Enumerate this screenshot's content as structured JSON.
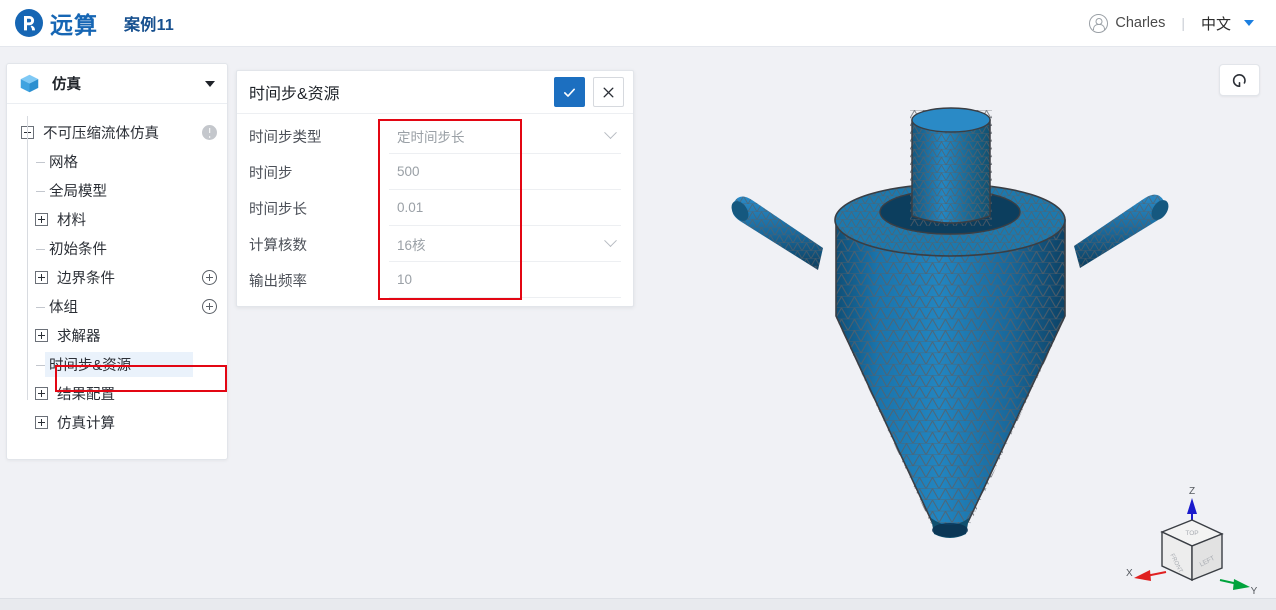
{
  "header": {
    "logo_icon": "yuansuan-logo-icon",
    "brand": "远算",
    "case_title": "案例11",
    "user_icon": "user-circle-icon",
    "user_name": "Charles",
    "divider": "|",
    "language": "中文",
    "caret_icon": "chevron-down-icon",
    "brand_color": "#1666B4",
    "title_color": "#17508F"
  },
  "sidebar": {
    "header": {
      "icon": "cube-icon",
      "label": "仿真",
      "caret_icon": "caret-down-icon"
    },
    "tree": [
      {
        "label": "不可压缩流体仿真",
        "toggle": "minus",
        "level": 0,
        "trailing": "info-icon"
      },
      {
        "label": "网格",
        "toggle": "none",
        "level": 1,
        "trailing": ""
      },
      {
        "label": "全局模型",
        "toggle": "none",
        "level": 1,
        "trailing": ""
      },
      {
        "label": "材料",
        "toggle": "plus",
        "level": 1,
        "trailing": ""
      },
      {
        "label": "初始条件",
        "toggle": "none",
        "level": 1,
        "trailing": ""
      },
      {
        "label": "边界条件",
        "toggle": "plus",
        "level": 1,
        "trailing": "plus-circle-icon"
      },
      {
        "label": "体组",
        "toggle": "none",
        "level": 1,
        "trailing": "plus-circle-icon"
      },
      {
        "label": "求解器",
        "toggle": "plus",
        "level": 1,
        "trailing": ""
      },
      {
        "label": "时间步&资源",
        "toggle": "none",
        "level": 1,
        "trailing": "",
        "selected": true
      },
      {
        "label": "结果配置",
        "toggle": "plus",
        "level": 1,
        "trailing": ""
      },
      {
        "label": "仿真计算",
        "toggle": "plus",
        "level": 1,
        "trailing": ""
      }
    ],
    "selection_color": "#EAF2FB"
  },
  "properties_panel": {
    "title": "时间步&资源",
    "confirm_icon": "check-icon",
    "confirm_color": "#1C6FC0",
    "cancel_icon": "close-icon",
    "rows": [
      {
        "label": "时间步类型",
        "value": "定时间步长",
        "control": "dropdown"
      },
      {
        "label": "时间步",
        "value": "500",
        "control": "text"
      },
      {
        "label": "时间步长",
        "value": "0.01",
        "control": "text"
      },
      {
        "label": "计算核数",
        "value": "16核",
        "control": "dropdown"
      },
      {
        "label": "输出频率",
        "value": "10",
        "control": "text"
      }
    ]
  },
  "annotations": {
    "color": "#E30613",
    "boxes": [
      "form-fields-highlight",
      "sidebar-selected-item-highlight"
    ]
  },
  "viewport": {
    "reset_view_icon": "reset-view-icon",
    "background_color": "#F0F1F5",
    "model": {
      "name": "hydrocyclone-mesh",
      "surface_color": "#1B72A8",
      "wireframe_color": "#5A5F66"
    },
    "view_cube": {
      "icon": "view-cube-icon",
      "face_top": "TOP",
      "face_front": "FRONT",
      "face_left": "LEFT",
      "axes": [
        {
          "label": "X",
          "color": "#E02020"
        },
        {
          "label": "Y",
          "color": "#00A33C"
        },
        {
          "label": "Z",
          "color": "#1A1ACC"
        }
      ]
    }
  }
}
